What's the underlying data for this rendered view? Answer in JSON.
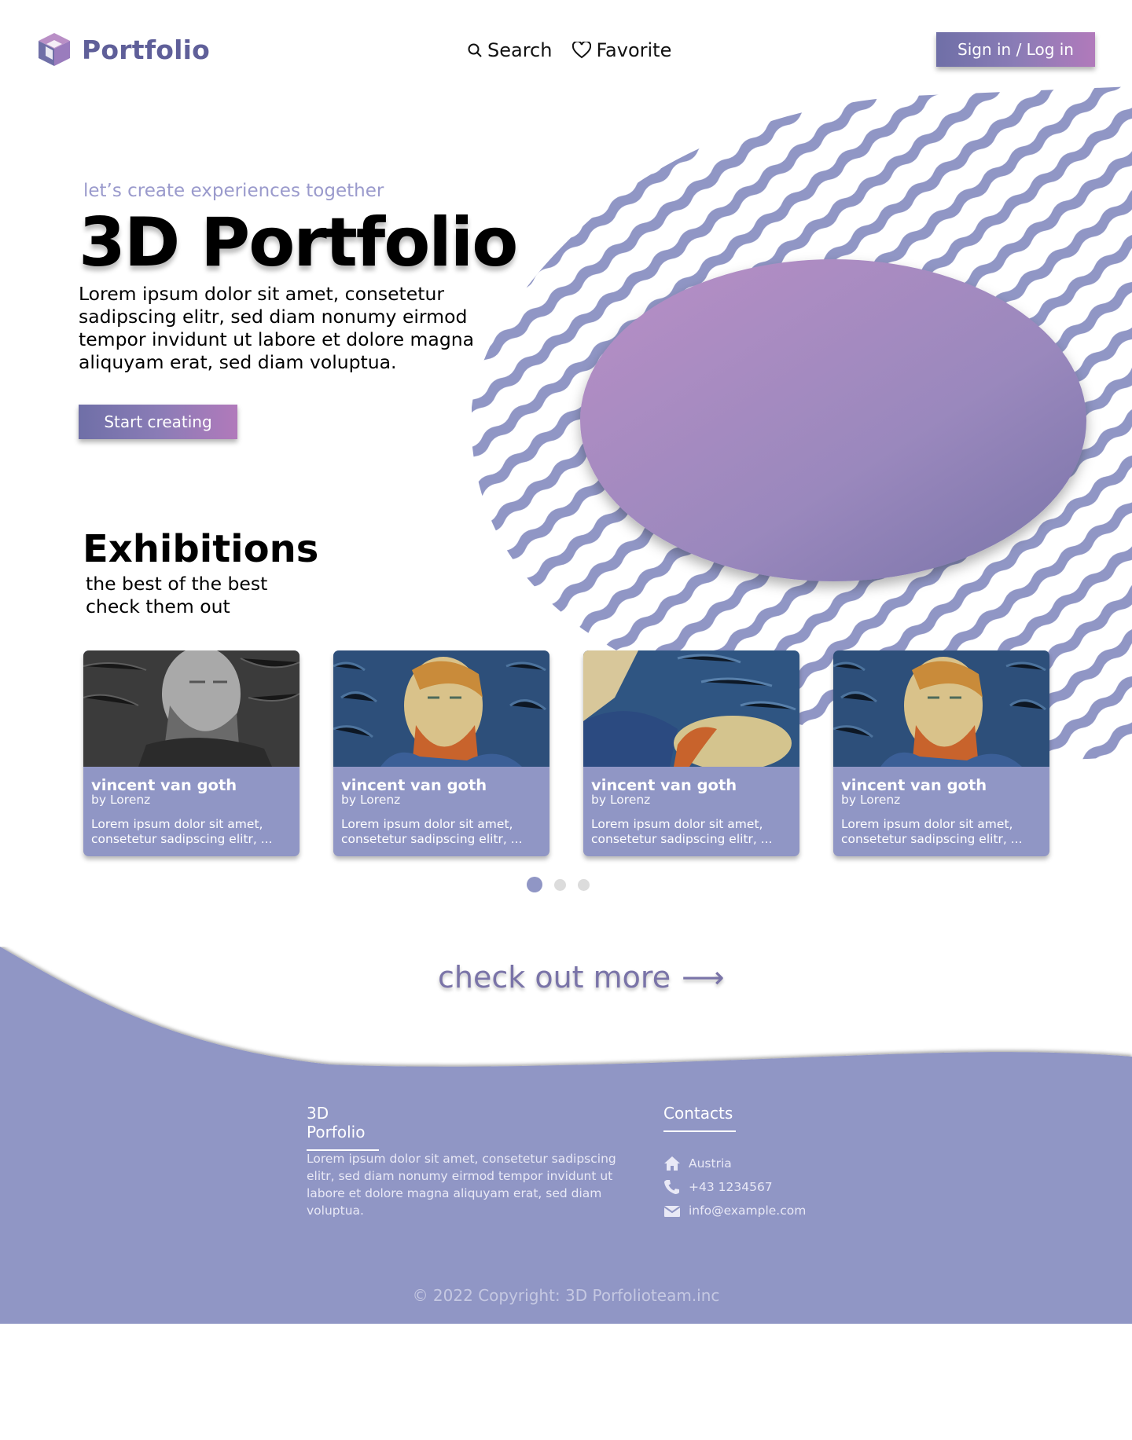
{
  "header": {
    "logo_text": "Portfolio",
    "nav": {
      "search_label": "Search",
      "favorite_label": "Favorite"
    },
    "signin_label": "Sign in / Log in"
  },
  "hero": {
    "tagline": "let’s create experiences together",
    "title": "3D Portfolio",
    "text": "Lorem ipsum dolor sit amet, consetetur sadipscing elitr, sed diam nonumy eirmod tempor invidunt ut labore et dolore magna aliquyam erat, sed diam voluptua.",
    "cta_label": "Start creating"
  },
  "exhibitions": {
    "title": "Exhibitions",
    "subtitle_line1": "the best of the best",
    "subtitle_line2": "check them out",
    "cards": [
      {
        "title": "vincent van goth",
        "author": "by Lorenz",
        "desc_line1": "Lorem ipsum dolor sit amet,",
        "desc_line2": "consetetur sadipscing elitr, ...",
        "image": "grayscale-portrait"
      },
      {
        "title": "vincent van goth",
        "author": "by Lorenz",
        "desc_line1": "Lorem ipsum dolor sit amet,",
        "desc_line2": "consetetur sadipscing elitr, ...",
        "image": "self-portrait"
      },
      {
        "title": "vincent van goth",
        "author": "by Lorenz",
        "desc_line1": "Lorem ipsum dolor sit amet,",
        "desc_line2": "consetetur sadipscing elitr, ...",
        "image": "reclining-portrait"
      },
      {
        "title": "vincent van goth",
        "author": "by Lorenz",
        "desc_line1": "Lorem ipsum dolor sit amet,",
        "desc_line2": "consetetur sadipscing elitr, ...",
        "image": "self-portrait"
      }
    ],
    "pagination": {
      "pages": 3,
      "active": 1
    }
  },
  "more": {
    "label": "check out more",
    "arrow": "⟶"
  },
  "footer": {
    "about_head": "3D Porfolio",
    "about_text": "Lorem ipsum dolor sit amet, consetetur sadipscing elitr, sed diam nonumy eirmod tempor invidunt ut labore et dolore magna aliquyam erat, sed diam voluptua.",
    "contacts_head": "Contacts",
    "address": "Austria",
    "phone": "+43 1234567",
    "email": "info@example.com",
    "copyright": "© 2022 Copyright: 3D Porfolioteam.inc"
  },
  "colors": {
    "brand": "#5f5f99",
    "accent": "#9096c5",
    "gradient_start": "#6f6fa7",
    "gradient_end": "#b17abb"
  }
}
